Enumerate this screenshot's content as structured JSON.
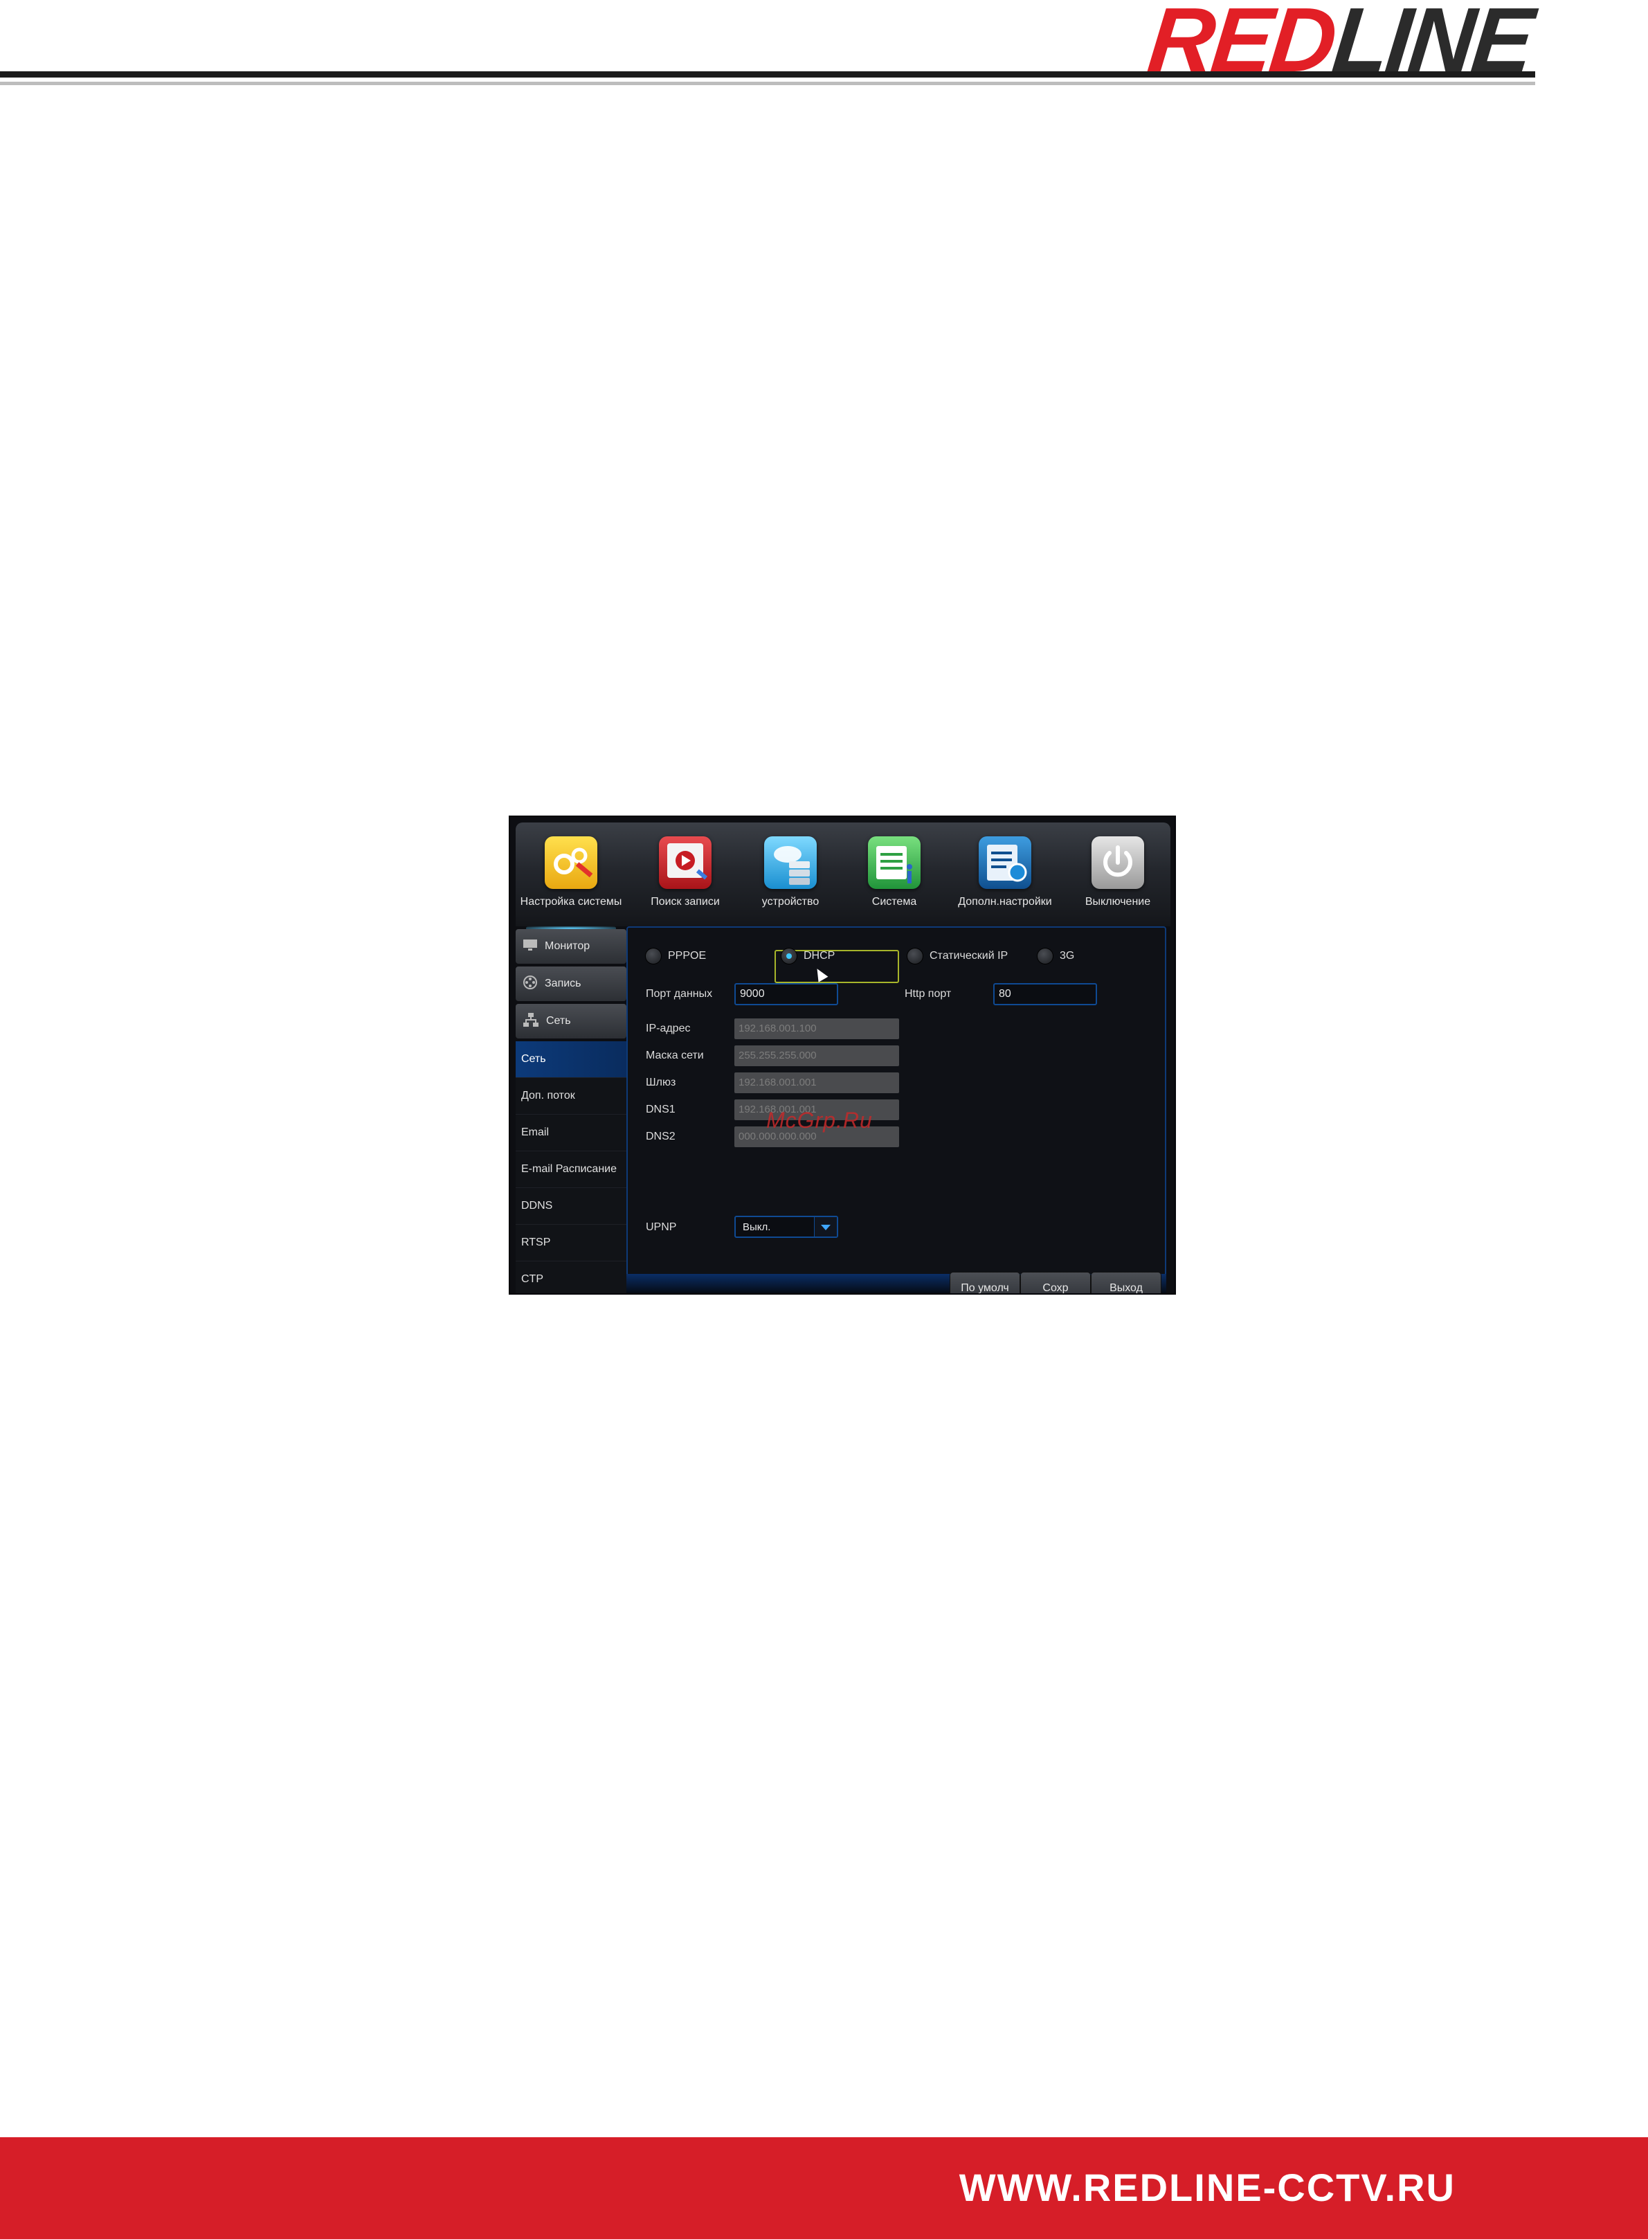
{
  "brand": {
    "logo_red": "RED",
    "logo_dark": "LINE",
    "footer_url": "WWW.REDLINE-CCTV.RU",
    "colors": {
      "red": "#e21f26",
      "dark": "#2b2b2b",
      "footer": "#d61e28"
    }
  },
  "dvr": {
    "top_menu": [
      {
        "label": "Настройка системы",
        "icon": "settings-gears-icon",
        "color": "#f2c21a",
        "active": true
      },
      {
        "label": "Поиск записи",
        "icon": "record-search-icon",
        "color": "#d1242b"
      },
      {
        "label": "устройство",
        "icon": "device-storage-icon",
        "color": "#27a8e0"
      },
      {
        "label": "Система",
        "icon": "system-info-icon",
        "color": "#3bb54a"
      },
      {
        "label": "Дополн.настройки",
        "icon": "advanced-settings-icon",
        "color": "#1c6fb8"
      },
      {
        "label": "Выключение",
        "icon": "power-icon",
        "color": "#b9b9b9"
      }
    ],
    "sidebar": {
      "groups": [
        {
          "label": "Монитор",
          "icon": "monitor-icon"
        },
        {
          "label": "Запись",
          "icon": "record-reel-icon"
        },
        {
          "label": "Сеть",
          "icon": "network-icon"
        }
      ],
      "items": [
        {
          "label": "Сеть",
          "active": true
        },
        {
          "label": "Доп. поток"
        },
        {
          "label": "Email"
        },
        {
          "label": "E-mail Расписание"
        },
        {
          "label": "DDNS"
        },
        {
          "label": "RTSP"
        },
        {
          "label": "CTP"
        }
      ]
    },
    "network": {
      "modes": [
        {
          "label": "PPPOE",
          "selected": false
        },
        {
          "label": "DHCP",
          "selected": true
        },
        {
          "label": "Статический IP",
          "selected": false
        },
        {
          "label": "3G",
          "selected": false
        }
      ],
      "data_port_label": "Порт данных",
      "data_port_value": "9000",
      "http_port_label": "Http порт",
      "http_port_value": "80",
      "ip_label": "IP-адрес",
      "ip_value": "192.168.001.100",
      "mask_label": "Маска сети",
      "mask_value": "255.255.255.000",
      "gateway_label": "Шлюз",
      "gateway_value": "192.168.001.001",
      "dns1_label": "DNS1",
      "dns1_value": "192.168.001.001",
      "dns2_label": "DNS2",
      "dns2_value": "000.000.000.000",
      "upnp_label": "UPNP",
      "upnp_value": "Выкл.",
      "watermark": "McGrp.Ru"
    },
    "buttons": {
      "default": "По умолч",
      "save": "Сохр",
      "exit": "Выход"
    }
  }
}
